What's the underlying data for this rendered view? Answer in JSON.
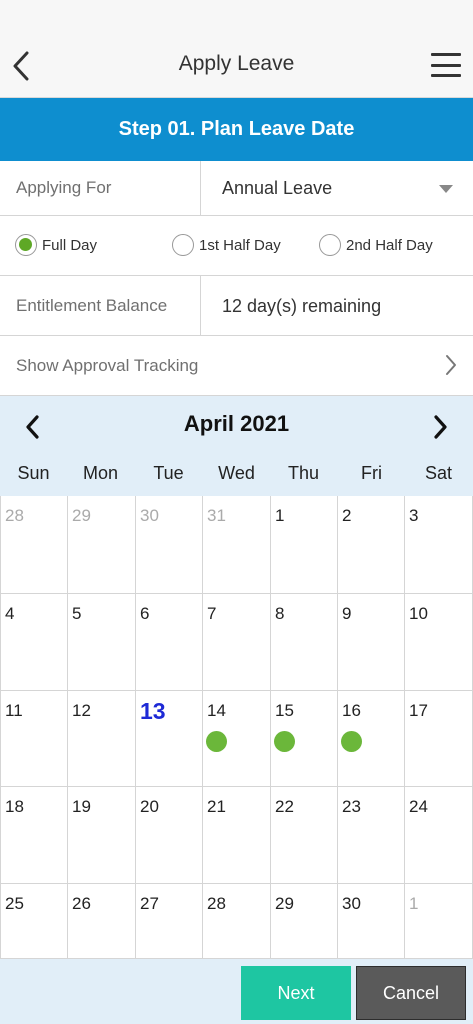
{
  "header": {
    "title": "Apply Leave",
    "back_icon": "chevron-left-icon",
    "menu_icon": "hamburger-menu-icon"
  },
  "step": {
    "title": "Step 01. Plan Leave Date"
  },
  "form": {
    "applying_for": {
      "label": "Applying For",
      "value": "Annual Leave"
    },
    "duration": {
      "options": [
        "Full Day",
        "1st Half Day",
        "2nd Half Day"
      ],
      "selected": "Full Day"
    },
    "entitlement": {
      "label": "Entitlement Balance",
      "value": "12 day(s) remaining"
    },
    "approval_tracking": {
      "label": "Show Approval Tracking"
    }
  },
  "calendar": {
    "month_label": "April 2021",
    "weekdays": [
      "Sun",
      "Mon",
      "Tue",
      "Wed",
      "Thu",
      "Fri",
      "Sat"
    ],
    "today": "13",
    "weeks": [
      [
        {
          "d": "28",
          "other": true
        },
        {
          "d": "29",
          "other": true
        },
        {
          "d": "30",
          "other": true
        },
        {
          "d": "31",
          "other": true
        },
        {
          "d": "1"
        },
        {
          "d": "2"
        },
        {
          "d": "3"
        }
      ],
      [
        {
          "d": "4"
        },
        {
          "d": "5"
        },
        {
          "d": "6"
        },
        {
          "d": "7"
        },
        {
          "d": "8"
        },
        {
          "d": "9"
        },
        {
          "d": "10"
        }
      ],
      [
        {
          "d": "11"
        },
        {
          "d": "12"
        },
        {
          "d": "13",
          "today": true
        },
        {
          "d": "14",
          "leave": true
        },
        {
          "d": "15",
          "leave": true
        },
        {
          "d": "16",
          "leave": true
        },
        {
          "d": "17"
        }
      ],
      [
        {
          "d": "18"
        },
        {
          "d": "19"
        },
        {
          "d": "20"
        },
        {
          "d": "21"
        },
        {
          "d": "22"
        },
        {
          "d": "23"
        },
        {
          "d": "24"
        }
      ],
      [
        {
          "d": "25"
        },
        {
          "d": "26"
        },
        {
          "d": "27"
        },
        {
          "d": "28"
        },
        {
          "d": "29"
        },
        {
          "d": "30"
        },
        {
          "d": "1",
          "other": true
        }
      ]
    ]
  },
  "actions": {
    "next": "Next",
    "cancel": "Cancel"
  },
  "colors": {
    "accent": "#0e8ecf",
    "selected_radio": "#5ea826",
    "leave_dot": "#6bb73a",
    "today": "#1e2ad6",
    "next_button": "#1ec6a2",
    "cancel_button": "#5a5a5a"
  }
}
